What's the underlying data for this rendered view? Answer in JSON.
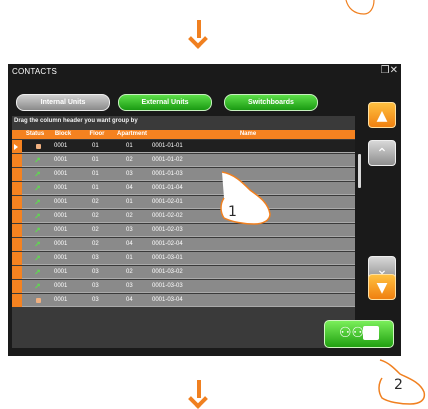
{
  "window": {
    "title": "CONTACTS",
    "controls": "❒✕"
  },
  "tabs": [
    {
      "label": "Internal Units",
      "state": "inactive"
    },
    {
      "label": "External Units",
      "state": "active"
    },
    {
      "label": "Switchboards",
      "state": "active"
    }
  ],
  "grid": {
    "group_hint": "Drag the column header you want group by",
    "headers": [
      "Status",
      "Block",
      "Floor",
      "Apartment",
      "Name"
    ],
    "rows": [
      {
        "status": "square",
        "block": "0001",
        "floor": "01",
        "apartment": "01",
        "name": "0001-01-01",
        "selected": true
      },
      {
        "status": "arrow",
        "block": "0001",
        "floor": "01",
        "apartment": "02",
        "name": "0001-01-02"
      },
      {
        "status": "arrow",
        "block": "0001",
        "floor": "01",
        "apartment": "03",
        "name": "0001-01-03"
      },
      {
        "status": "arrow",
        "block": "0001",
        "floor": "01",
        "apartment": "04",
        "name": "0001-01-04"
      },
      {
        "status": "arrow",
        "block": "0001",
        "floor": "02",
        "apartment": "01",
        "name": "0001-02-01"
      },
      {
        "status": "arrow",
        "block": "0001",
        "floor": "02",
        "apartment": "02",
        "name": "0001-02-02"
      },
      {
        "status": "arrow",
        "block": "0001",
        "floor": "02",
        "apartment": "03",
        "name": "0001-02-03"
      },
      {
        "status": "arrow",
        "block": "0001",
        "floor": "02",
        "apartment": "04",
        "name": "0001-02-04"
      },
      {
        "status": "arrow",
        "block": "0001",
        "floor": "03",
        "apartment": "01",
        "name": "0001-03-01"
      },
      {
        "status": "arrow",
        "block": "0001",
        "floor": "03",
        "apartment": "02",
        "name": "0001-03-02"
      },
      {
        "status": "arrow",
        "block": "0001",
        "floor": "03",
        "apartment": "03",
        "name": "0001-03-03"
      },
      {
        "status": "square",
        "block": "0001",
        "floor": "03",
        "apartment": "04",
        "name": "0001-03-04"
      }
    ]
  },
  "side_buttons": [
    {
      "icon": "double-chevron-up-icon"
    },
    {
      "icon": "house-up-icon"
    },
    {
      "icon": "house-down-icon"
    },
    {
      "icon": "double-chevron-down-icon"
    }
  ],
  "action": {
    "icon": "add-contact-icon"
  },
  "callouts": [
    "1",
    "2"
  ],
  "colors": {
    "accent": "#f58220",
    "green": "#2fb81f",
    "screen": "#1a1a1a"
  }
}
